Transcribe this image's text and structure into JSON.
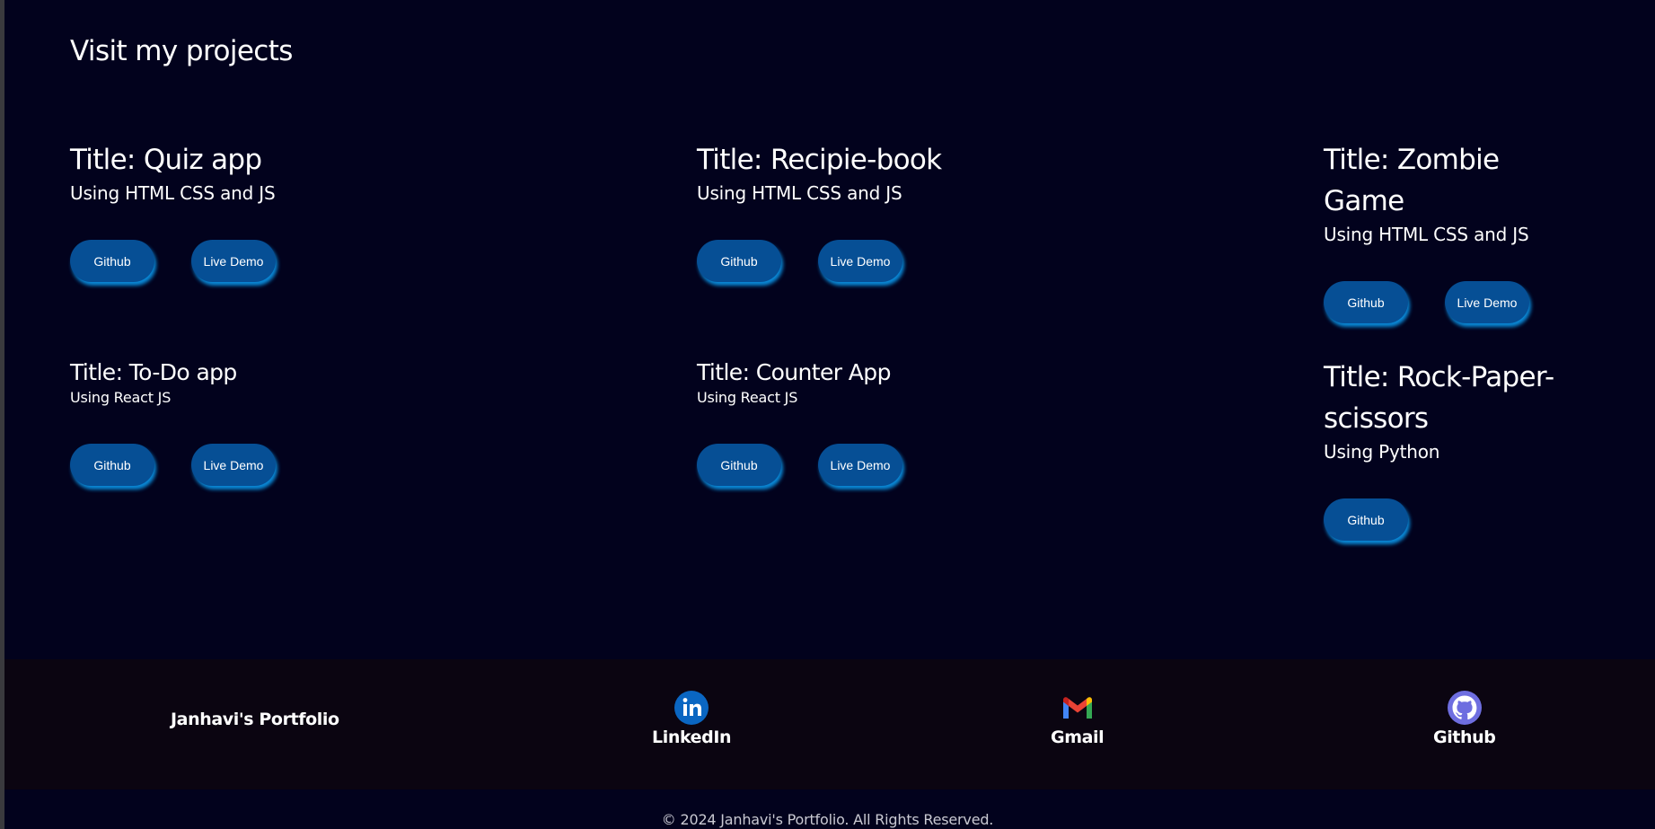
{
  "projects_section": {
    "heading": "Visit my projects",
    "projects": [
      {
        "title": "Title: Quiz app",
        "tech": "Using HTML CSS and JS",
        "github_label": "Github",
        "demo_label": "Live Demo"
      },
      {
        "title": "Title: Recipie-book",
        "tech": "Using HTML CSS and JS",
        "github_label": "Github",
        "demo_label": "Live Demo"
      },
      {
        "title": "Title: Zombie Game",
        "tech": "Using HTML CSS and JS",
        "github_label": "Github",
        "demo_label": "Live Demo"
      },
      {
        "title": "Title: To-Do app",
        "tech": "Using React JS",
        "github_label": "Github",
        "demo_label": "Live Demo"
      },
      {
        "title": "Title: Counter App",
        "tech": "Using React JS",
        "github_label": "Github",
        "demo_label": "Live Demo"
      },
      {
        "title": "Title: Rock-Paper-scissors",
        "tech": "Using Python",
        "github_label": "Github"
      }
    ]
  },
  "footer": {
    "brand": "Janhavi's Portfolio",
    "links": [
      {
        "label": "LinkedIn",
        "icon": "linkedin-icon"
      },
      {
        "label": "Gmail",
        "icon": "gmail-icon"
      },
      {
        "label": "Github",
        "icon": "github-icon"
      }
    ],
    "copyright": "© 2024 Janhavi's Portfolio. All Rights Reserved."
  },
  "colors": {
    "background": "#02021d",
    "footer_band": "#0b0511",
    "button": "#064f95",
    "button_glow": "#0a8ad9",
    "linkedin": "#0a66c2",
    "github_icon": "#6e6ee0"
  }
}
